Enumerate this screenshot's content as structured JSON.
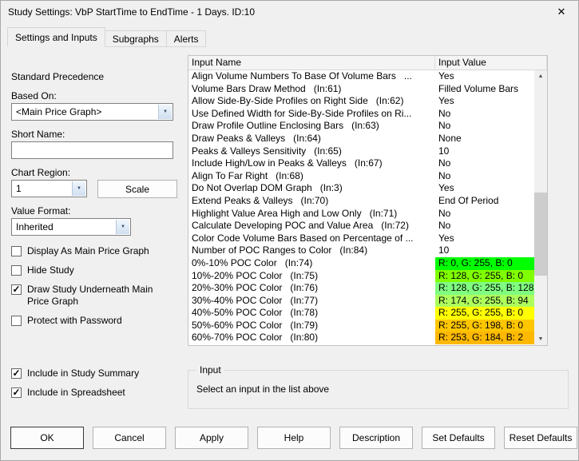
{
  "window": {
    "title": "Study Settings: VbP StartTime to EndTime - 1 Days. ID:10"
  },
  "icons": {
    "close": "✕",
    "combo_arrow": "▼",
    "scroll_up": "▲",
    "scroll_down": "▼",
    "check": "✓"
  },
  "tabs": [
    {
      "label": "Settings and Inputs",
      "active": true
    },
    {
      "label": "Subgraphs",
      "active": false
    },
    {
      "label": "Alerts",
      "active": false
    }
  ],
  "left_panel": {
    "section_label": "Standard Precedence",
    "based_on": {
      "label": "Based On:",
      "value": "<Main Price Graph>"
    },
    "short_name": {
      "label": "Short Name:",
      "value": ""
    },
    "chart_region": {
      "label": "Chart Region:",
      "value": "1",
      "scale_button": "Scale"
    },
    "value_format": {
      "label": "Value Format:",
      "value": "Inherited"
    },
    "checkboxes": [
      {
        "label": "Display As Main Price Graph",
        "checked": false
      },
      {
        "label": "Hide Study",
        "checked": false
      },
      {
        "label": "Draw Study Underneath Main Price Graph",
        "checked": true
      },
      {
        "label": "Protect with Password",
        "checked": false
      }
    ],
    "summary_checkboxes": [
      {
        "label": "Include in Study Summary",
        "checked": true
      },
      {
        "label": "Include in Spreadsheet",
        "checked": true
      }
    ]
  },
  "inputs_table": {
    "columns": [
      "Input Name",
      "Input Value"
    ],
    "rows": [
      {
        "name": "Align Volume Numbers To Base Of Volume Bars   ...",
        "value": "Yes"
      },
      {
        "name": "Volume Bars Draw Method   (In:61)",
        "value": "Filled Volume Bars"
      },
      {
        "name": "Allow Side-By-Side Profiles on Right Side   (In:62)",
        "value": "Yes"
      },
      {
        "name": "Use Defined Width for Side-By-Side Profiles on Ri...",
        "value": "No"
      },
      {
        "name": "Draw Profile Outline Enclosing Bars   (In:63)",
        "value": "No"
      },
      {
        "name": "Draw Peaks & Valleys   (In:64)",
        "value": "None"
      },
      {
        "name": "Peaks & Valleys Sensitivity   (In:65)",
        "value": "10"
      },
      {
        "name": "Include High/Low in Peaks & Valleys   (In:67)",
        "value": "No"
      },
      {
        "name": "Align To Far Right   (In:68)",
        "value": "No"
      },
      {
        "name": "Do Not Overlap DOM Graph   (In:3)",
        "value": "Yes"
      },
      {
        "name": "Extend Peaks & Valleys   (In:70)",
        "value": "End Of Period"
      },
      {
        "name": "Highlight Value Area High and Low Only   (In:71)",
        "value": "No"
      },
      {
        "name": "Calculate Developing POC and Value Area   (In:72)",
        "value": "No"
      },
      {
        "name": "Color Code Volume Bars Based on Percentage of ...",
        "value": "Yes"
      },
      {
        "name": "Number of POC Ranges to Color   (In:84)",
        "value": "10"
      },
      {
        "name": "0%-10% POC Color   (In:74)",
        "value": "R: 0, G: 255, B: 0",
        "color": "#00ff00"
      },
      {
        "name": "10%-20% POC Color   (In:75)",
        "value": "R: 128, G: 255, B: 0",
        "color": "#80ff00"
      },
      {
        "name": "20%-30% POC Color   (In:76)",
        "value": "R: 128, G: 255, B: 128",
        "color": "#80ff80"
      },
      {
        "name": "30%-40% POC Color   (In:77)",
        "value": "R: 174, G: 255, B: 94",
        "color": "#aeff5e"
      },
      {
        "name": "40%-50% POC Color   (In:78)",
        "value": "R: 255, G: 255, B: 0",
        "color": "#ffff00"
      },
      {
        "name": "50%-60% POC Color   (In:79)",
        "value": "R: 255, G: 198, B: 0",
        "color": "#ffc600"
      },
      {
        "name": "60%-70% POC Color   (In:80)",
        "value": "R: 253, G: 184, B: 2",
        "color": "#fdb802"
      }
    ]
  },
  "input_group": {
    "label": "Input",
    "message": "Select an input in the list above"
  },
  "buttons": [
    {
      "label": "OK",
      "default": true
    },
    {
      "label": "Cancel"
    },
    {
      "label": "Apply"
    },
    {
      "label": "Help"
    },
    {
      "label": "Description"
    },
    {
      "label": "Set Defaults"
    },
    {
      "label": "Reset Defaults"
    }
  ]
}
